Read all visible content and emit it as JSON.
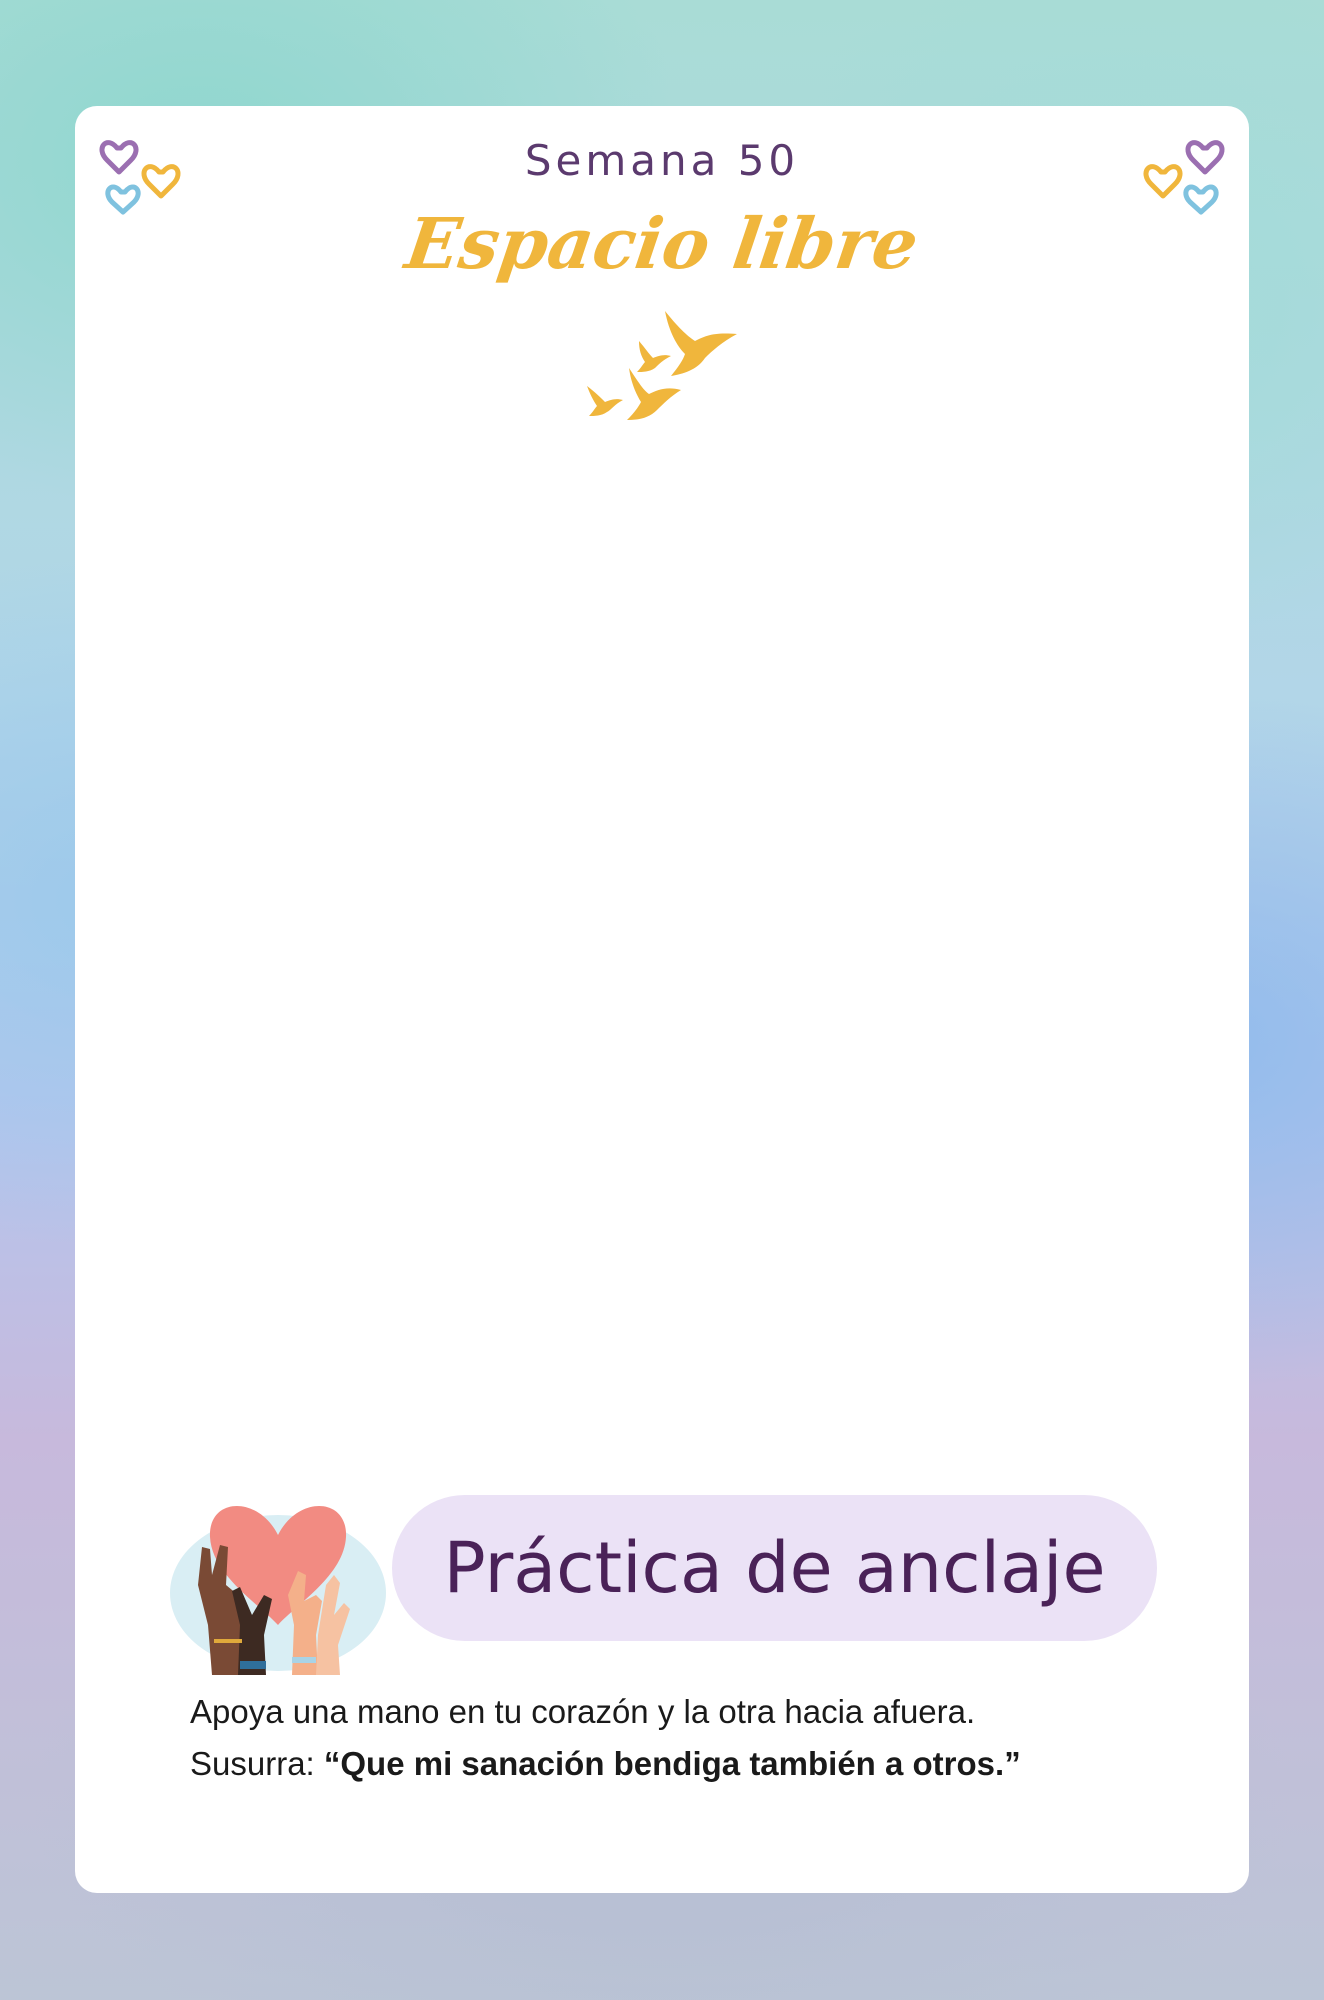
{
  "header": {
    "week_label": "Semana 50",
    "title": "Espacio libre"
  },
  "practice": {
    "label": "Práctica de anclaje",
    "line1": "Apoya una mano en tu corazón y la otra hacia afuera.",
    "line2_prefix": "Susurra: ",
    "line2_quote": "“Que mi sanación bendiga también a otros.”"
  },
  "colors": {
    "accent_gold": "#f0b63c",
    "accent_purple": "#5b3a6e",
    "heart_purple": "#9b6fb1",
    "heart_blue": "#7fc2df",
    "pill_bg": "#ebe2f6"
  },
  "icons": [
    "hearts-doodle-icon",
    "birds-icon",
    "hands-heart-icon"
  ]
}
